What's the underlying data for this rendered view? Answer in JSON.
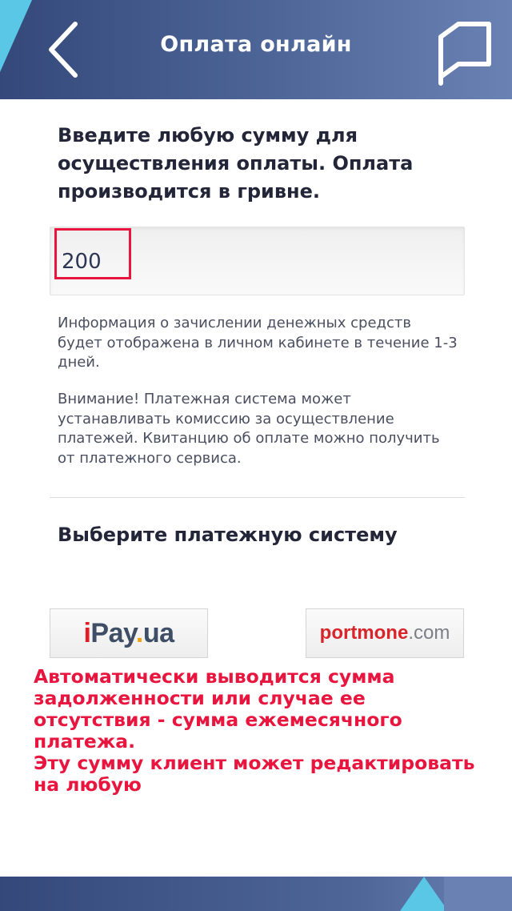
{
  "header": {
    "title": "Оплата онлайн",
    "back_icon": "chevron-left-icon",
    "chat_icon": "chat-bubble-icon",
    "color": "#4f6699",
    "accent": "#5bc7e6"
  },
  "main": {
    "intro_text": "Введите любую сумму для осуществления оплаты. Оплата производится в гривне.",
    "amount_value": "200",
    "info_text": "Информация о зачислении денежных средств будет отображена в личном кабинете в течение 1-3 дней.",
    "warning_text": "Внимание! Платежная система может устанавливать комиссию за осуществление платежей. Квитанцию об оплате можно получить от платежного сервиса.",
    "choose_system": "Выберите платежную систему"
  },
  "payment_systems": {
    "ipay": {
      "part1": "i",
      "part2": "Pay",
      "part3": ".",
      "part4": "ua"
    },
    "portmone": {
      "part1": "portmone",
      "part2": ".com"
    }
  },
  "annotation": {
    "line1": "Автоматически выводится сумма задолженности или  случае ее отсутствия - сумма ежемесячного платежа.",
    "line2": "Эту сумму клиент может редактировать на любую",
    "color": "#e8163f"
  }
}
